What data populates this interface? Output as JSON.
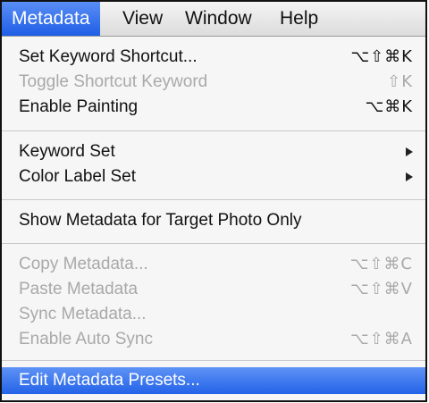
{
  "menubar": {
    "items": [
      {
        "label": "Metadata"
      },
      {
        "label": "View"
      },
      {
        "label": "Window"
      },
      {
        "label": "Help"
      }
    ]
  },
  "menu": {
    "items": [
      {
        "label": "Set Keyword Shortcut...",
        "shortcut": "⌥⇧⌘K",
        "enabled": true
      },
      {
        "label": "Toggle Shortcut Keyword",
        "shortcut": "⇧K",
        "enabled": false
      },
      {
        "label": "Enable Painting",
        "shortcut": "⌥⌘K",
        "enabled": true
      },
      {
        "label": "Keyword Set",
        "submenu": true,
        "enabled": true
      },
      {
        "label": "Color Label Set",
        "submenu": true,
        "enabled": true
      },
      {
        "label": "Show Metadata for Target Photo Only",
        "enabled": true
      },
      {
        "label": "Copy Metadata...",
        "shortcut": "⌥⇧⌘C",
        "enabled": false
      },
      {
        "label": "Paste Metadata",
        "shortcut": "⌥⇧⌘V",
        "enabled": false
      },
      {
        "label": "Sync Metadata...",
        "enabled": false
      },
      {
        "label": "Enable Auto Sync",
        "shortcut": "⌥⇧⌘A",
        "enabled": false
      },
      {
        "label": "Edit Metadata Presets...",
        "enabled": true,
        "highlighted": true
      }
    ]
  },
  "colors": {
    "highlight": "#2463e8",
    "disabled_text": "#a9a9a9"
  }
}
